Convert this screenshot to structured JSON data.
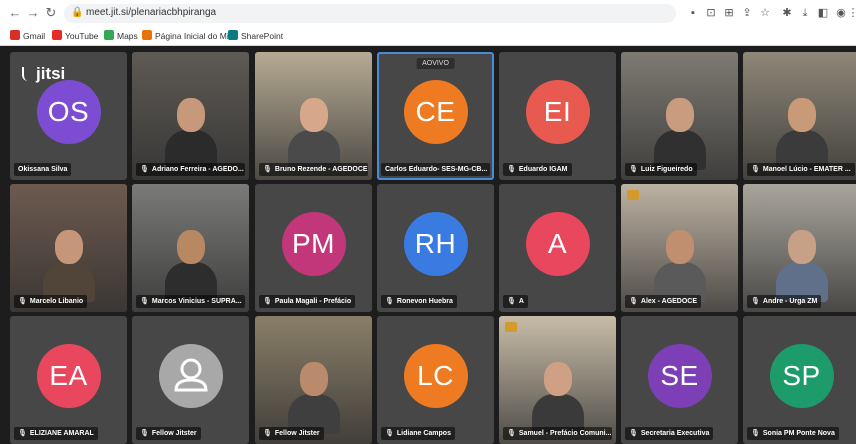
{
  "browser": {
    "url": "meet.jit.si/plenariacbhpiranga",
    "bookmarks": [
      {
        "label": "Gmail",
        "color": "#d93025"
      },
      {
        "label": "YouTube",
        "color": "#e52d27"
      },
      {
        "label": "Maps",
        "color": "#34a853"
      },
      {
        "label": "Página Inicial do Mi...",
        "color": "#e8710a"
      },
      {
        "label": "SharePoint",
        "color": "#0a7b83"
      }
    ]
  },
  "app": {
    "logo": "jitsi"
  },
  "tiles": [
    {
      "name": "Okissana Silva",
      "initials": "OS",
      "color": "#7c4dd2",
      "type": "avatar"
    },
    {
      "name": "Adriano Ferreira - AGEDO...",
      "type": "video",
      "bg": "#5e5a55",
      "skin": "#c8987a",
      "shirt": "#2b2b2b"
    },
    {
      "name": "Bruno Rezende - AGEDOCE",
      "type": "video",
      "bg": "#b6aa93",
      "skin": "#d6a788",
      "shirt": "#4a4a4a"
    },
    {
      "name": "Carlos Eduardo- SES-MG-CB...",
      "initials": "CE",
      "color": "#ee7a21",
      "type": "avatar",
      "badge": "AOVIVO",
      "active": true
    },
    {
      "name": "Eduardo IGAM",
      "initials": "EI",
      "color": "#e85a50",
      "type": "avatar"
    },
    {
      "name": "Luiz Figueiredo",
      "type": "video",
      "bg": "#7e7a73",
      "skin": "#c99c7f",
      "shirt": "#303030"
    },
    {
      "name": "Manoel Lúcio - EMATER ...",
      "type": "video",
      "bg": "#8e8778",
      "skin": "#c89a78",
      "shirt": "#3b3b3b"
    },
    {
      "name": "Marcelo Libanio",
      "type": "video",
      "bg": "#6d5a4f",
      "skin": "#c6967a",
      "shirt": "#514539"
    },
    {
      "name": "Marcos Vinicius - SUPRA...",
      "type": "video",
      "bg": "#7a7a78",
      "skin": "#b88863",
      "shirt": "#2d2d2d"
    },
    {
      "name": "Paula Magali - Prefácio",
      "initials": "PM",
      "color": "#c2367a",
      "type": "avatar"
    },
    {
      "name": "Ronevon Huebra",
      "initials": "RH",
      "color": "#3a7be2",
      "type": "avatar"
    },
    {
      "name": "A",
      "initials": "A",
      "color": "#e8475d",
      "type": "avatar"
    },
    {
      "name": "Alex - AGEDOCE",
      "type": "video",
      "bg": "#bdb2a2",
      "skin": "#bf8f70",
      "shirt": "#5a5a5a",
      "signal": true
    },
    {
      "name": "Andre - Urga ZM",
      "type": "video",
      "bg": "#a9a59c",
      "skin": "#c7a085",
      "shirt": "#60708a"
    },
    {
      "name": "ELIZIANE AMARAL",
      "initials": "EA",
      "color": "#e8475d",
      "type": "avatar"
    },
    {
      "name": "Fellow Jitster",
      "type": "placeholder"
    },
    {
      "name": "Fellow Jitster",
      "type": "video",
      "bg": "#8a7e69",
      "skin": "#b98b6c",
      "shirt": "#3f3f3f"
    },
    {
      "name": "Lidiane Campos",
      "initials": "LC",
      "color": "#ee7a21",
      "type": "avatar"
    },
    {
      "name": "Samuel - Prefácio Comuni...",
      "type": "video",
      "bg": "#c7bca8",
      "skin": "#cfa083",
      "shirt": "#3a3a3a",
      "signal": true
    },
    {
      "name": "Secretaria Executiva",
      "initials": "SE",
      "color": "#7c3fb5",
      "type": "avatar"
    },
    {
      "name": "Sonia PM Ponte Nova",
      "initials": "SP",
      "color": "#1e9b6a",
      "type": "avatar"
    }
  ]
}
